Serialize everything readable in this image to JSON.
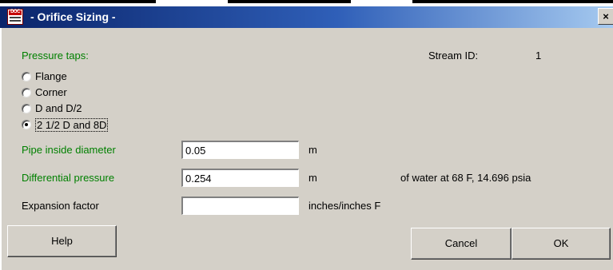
{
  "window": {
    "title": "- Orifice Sizing -",
    "close_glyph": "×",
    "icon_text": "DOC"
  },
  "pressure_taps": {
    "label": "Pressure taps:",
    "options": [
      "Flange",
      "Corner",
      "D and D/2",
      "2 1/2 D and 8D"
    ],
    "selected": "2 1/2 D and 8D"
  },
  "stream": {
    "label": "Stream ID:",
    "value": "1"
  },
  "pipe_diameter": {
    "label": "Pipe inside diameter",
    "value": "0.05",
    "unit": "m"
  },
  "differential_pressure": {
    "label": "Differential pressure",
    "value": "0.254",
    "unit": "m",
    "note": "of water at 68 F, 14.696 psia"
  },
  "expansion_factor": {
    "label": "Expansion factor",
    "value": "",
    "unit": "inches/inches F"
  },
  "buttons": {
    "help": "Help",
    "cancel": "Cancel",
    "ok": "OK"
  },
  "colors": {
    "label_green": "#008000",
    "title_bar_start": "#0a246a",
    "title_bar_end": "#a6caf0",
    "dialog_bg": "#d4d0c8"
  }
}
